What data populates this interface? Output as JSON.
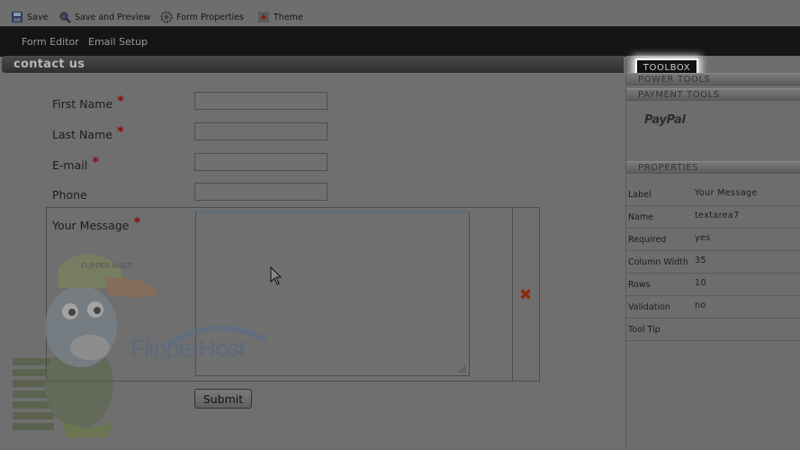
{
  "toolbar": {
    "save": "Save",
    "save_preview": "Save and Preview",
    "form_properties": "Form Properties",
    "theme": "Theme"
  },
  "nav": {
    "form_editor": "Form Editor",
    "email_setup": "Email Setup"
  },
  "form": {
    "title": "contact us",
    "fields": {
      "first_name": "First Name",
      "last_name": "Last Name",
      "email": "E-mail",
      "phone": "Phone",
      "message": "Your Message"
    },
    "required_mark": "*",
    "submit": "Submit",
    "delete_icon": "✖"
  },
  "right_panel": {
    "tabs": {
      "toolbox": "TOOLBOX",
      "power_tools": "POWER TOOLS",
      "payment_tools": "PAYMENT TOOLS"
    },
    "paypal": "PayPal",
    "properties_header": "PROPERTIES",
    "properties": [
      {
        "label": "Label",
        "value": "Your Message"
      },
      {
        "label": "Name",
        "value": "textarea7"
      },
      {
        "label": "Required",
        "value": "yes"
      },
      {
        "label": "Column Width",
        "value": "35"
      },
      {
        "label": "Rows",
        "value": "10"
      },
      {
        "label": "Validation",
        "value": "no"
      },
      {
        "label": "Tool Tip",
        "value": ""
      }
    ]
  },
  "logo": {
    "brand": "FlipperHost",
    "cap_text": "FLIPPER HOST"
  }
}
